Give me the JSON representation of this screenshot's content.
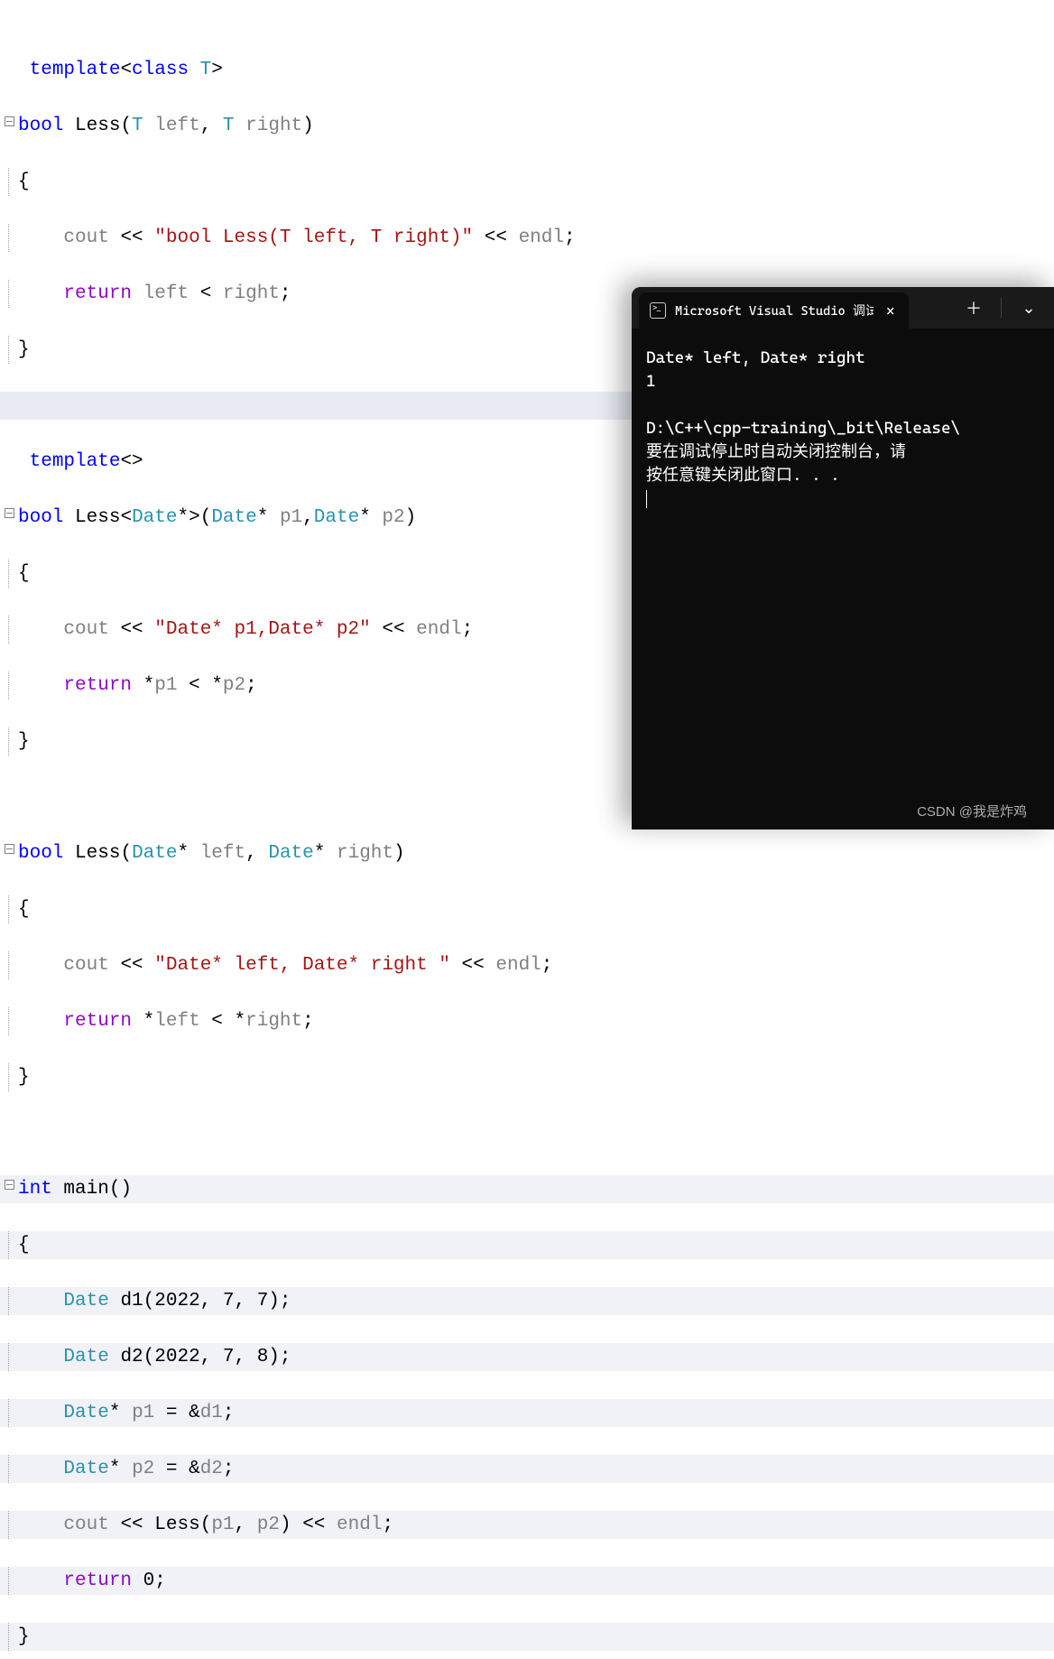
{
  "code": {
    "l1": {
      "kw1": "template",
      "punc1": "<",
      "kw2": "class",
      "T": "T",
      "punc2": ">"
    },
    "l2": {
      "kw": "bool",
      "fn": "Less",
      "p1": "(",
      "T1": "T",
      "a1": "left",
      "c": ",",
      "T2": "T",
      "a2": "right",
      "p2": ")"
    },
    "l3": "{",
    "l4": {
      "cout": "cout",
      "ll": "<<",
      "str": "\"bool Less(T left, T right)\"",
      "ll2": "<<",
      "endl": "endl",
      "semi": ";"
    },
    "l5": {
      "ret": "return",
      "a1": "left",
      "op": "<",
      "a2": "right",
      "semi": ";"
    },
    "l6": "}",
    "l8": {
      "kw": "template",
      "ab": "<>"
    },
    "l9": {
      "kw": "bool",
      "fn": "Less",
      "lt": "<",
      "D1": "Date",
      "star1": "*",
      "gt": ">",
      "p1": "(",
      "D2": "Date",
      "star2": "*",
      "a1": "p1",
      "c": ",",
      "D3": "Date",
      "star3": "*",
      "a2": "p2",
      "p2": ")"
    },
    "l10": "{",
    "l11": {
      "cout": "cout",
      "ll": "<<",
      "str": "\"Date* p1,Date* p2\"",
      "ll2": "<<",
      "endl": "endl",
      "semi": ";"
    },
    "l12": {
      "ret": "return",
      "star1": "*",
      "a1": "p1",
      "op": "<",
      "star2": "*",
      "a2": "p2",
      "semi": ";"
    },
    "l13": "}",
    "l15": {
      "kw": "bool",
      "fn": "Less",
      "p1": "(",
      "D1": "Date",
      "star1": "*",
      "a1": "left",
      "c": ",",
      "D2": "Date",
      "star2": "*",
      "a2": "right",
      "p2": ")"
    },
    "l16": "{",
    "l17": {
      "cout": "cout",
      "ll": "<<",
      "str": "\"Date* left, Date* right \"",
      "ll2": "<<",
      "endl": "endl",
      "semi": ";"
    },
    "l18": {
      "ret": "return",
      "star1": "*",
      "a1": "left",
      "op": "<",
      "star2": "*",
      "a2": "right",
      "semi": ";"
    },
    "l19": "}",
    "l21": {
      "kw": "int",
      "fn": "main",
      "p": "()"
    },
    "l22": "{",
    "l23": {
      "D": "Date",
      "v": "d1",
      "args": "(2022, 7, 7);"
    },
    "l24": {
      "D": "Date",
      "v": "d2",
      "args": "(2022, 7, 8);"
    },
    "l25": {
      "D": "Date",
      "star": "*",
      "v": "p1",
      "eq": " = &",
      "rhs": "d1",
      "semi": ";"
    },
    "l26": {
      "D": "Date",
      "star": "*",
      "v": "p2",
      "eq": " = &",
      "rhs": "d2",
      "semi": ";"
    },
    "l27": {
      "cout": "cout",
      "ll": "<<",
      "fn": "Less",
      "p1": "(",
      "a1": "p1",
      "c": ",",
      "a2": "p2",
      "p2": ")",
      "ll2": "<<",
      "endl": "endl",
      "semi": ";"
    },
    "l28": {
      "ret": "return",
      "zero": "0",
      "semi": ";"
    },
    "l29": "}"
  },
  "console": {
    "tab_title": "Microsoft Visual Studio 调试",
    "out_line1": "Date* left, Date* right",
    "out_line2": "1",
    "out_line3": "",
    "out_line4": "D:\\C++\\cpp-training\\_bit\\Release\\",
    "out_line5": "要在调试停止时自动关闭控制台，请",
    "out_line6": "按任意键关闭此窗口. . ."
  },
  "watermark": "CSDN @我是炸鸡"
}
